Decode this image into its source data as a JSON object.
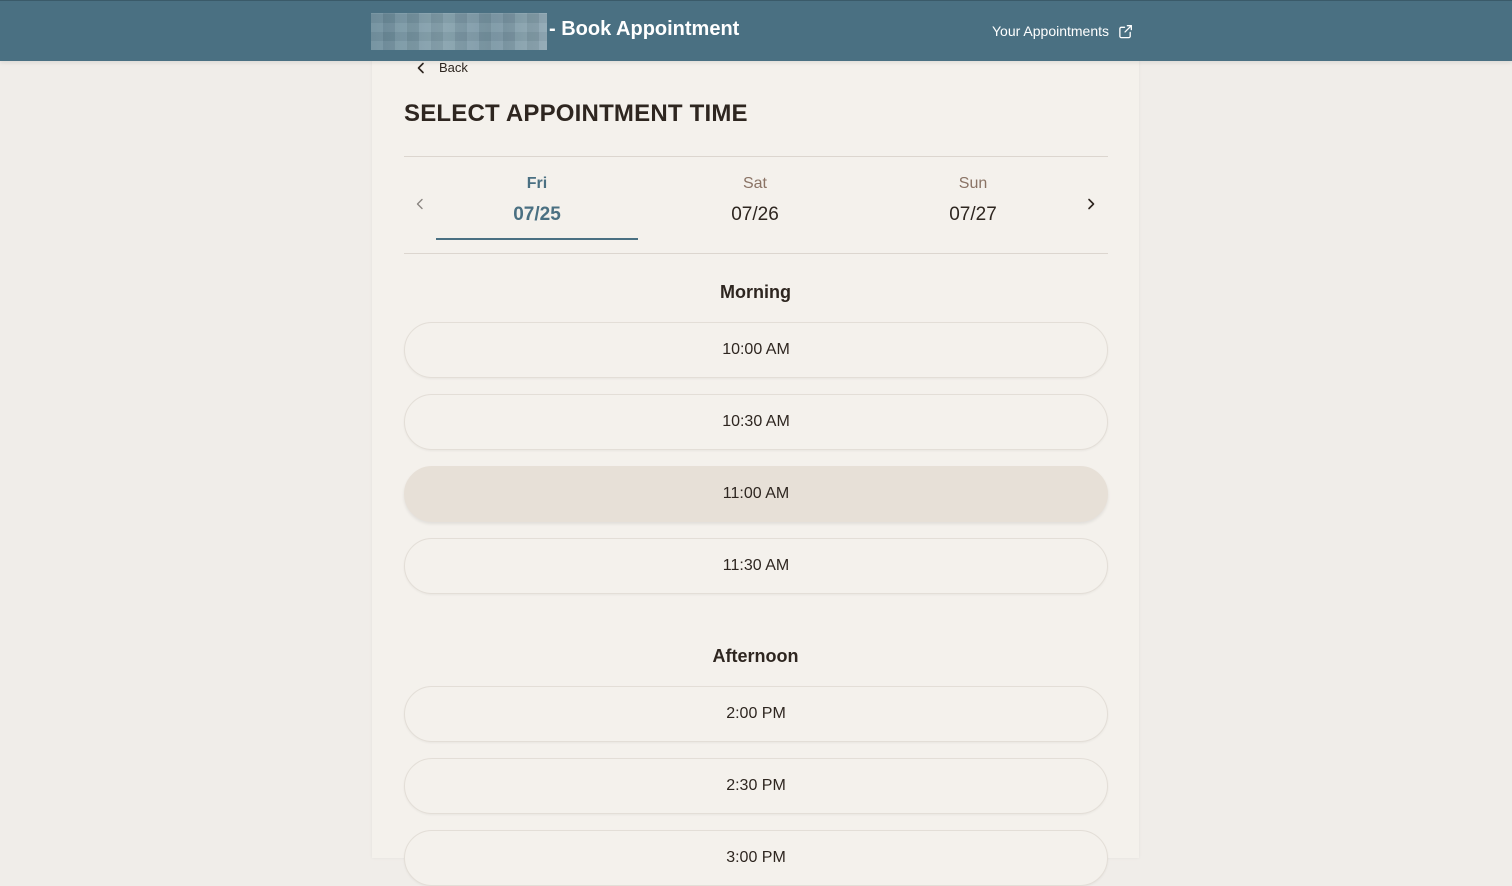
{
  "header": {
    "heading": "- Book Appointment",
    "appointments_link": "Your Appointments",
    "bg_color": "#4a7082"
  },
  "nav": {
    "back_label": "Back"
  },
  "page": {
    "title": "SELECT APPOINTMENT TIME"
  },
  "days": [
    {
      "dow": "Fri",
      "date": "07/25",
      "active": true
    },
    {
      "dow": "Sat",
      "date": "07/26",
      "active": false
    },
    {
      "dow": "Sun",
      "date": "07/27",
      "active": false
    }
  ],
  "sections": {
    "morning_label": "Morning",
    "afternoon_label": "Afternoon"
  },
  "morning_slots": [
    "10:00 AM",
    "10:30 AM",
    "11:00 AM",
    "11:30 AM"
  ],
  "afternoon_slots": [
    "2:00 PM",
    "2:30 PM",
    "3:00 PM"
  ],
  "selected_slot": "11:00 AM",
  "icons": {
    "back": "chevron-left-icon",
    "external": "external-link-icon",
    "prev_day": "chevron-left-icon",
    "next_day": "chevron-right-icon"
  }
}
